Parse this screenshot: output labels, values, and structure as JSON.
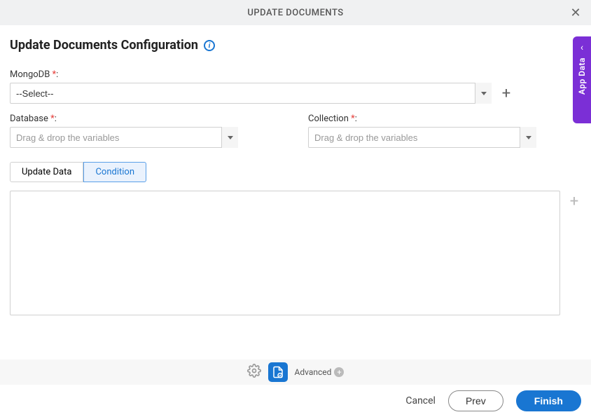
{
  "header": {
    "title": "UPDATE DOCUMENTS"
  },
  "page": {
    "title": "Update Documents Configuration"
  },
  "fields": {
    "mongodb": {
      "label": "MongoDB",
      "value": "--Select--"
    },
    "database": {
      "label": "Database",
      "placeholder": "Drag & drop the variables"
    },
    "collection": {
      "label": "Collection",
      "placeholder": "Drag & drop the variables"
    }
  },
  "tabs": {
    "update": "Update Data",
    "condition": "Condition"
  },
  "bottombar": {
    "advanced": "Advanced"
  },
  "footer": {
    "cancel": "Cancel",
    "prev": "Prev",
    "finish": "Finish"
  },
  "side": {
    "label": "App Data"
  }
}
